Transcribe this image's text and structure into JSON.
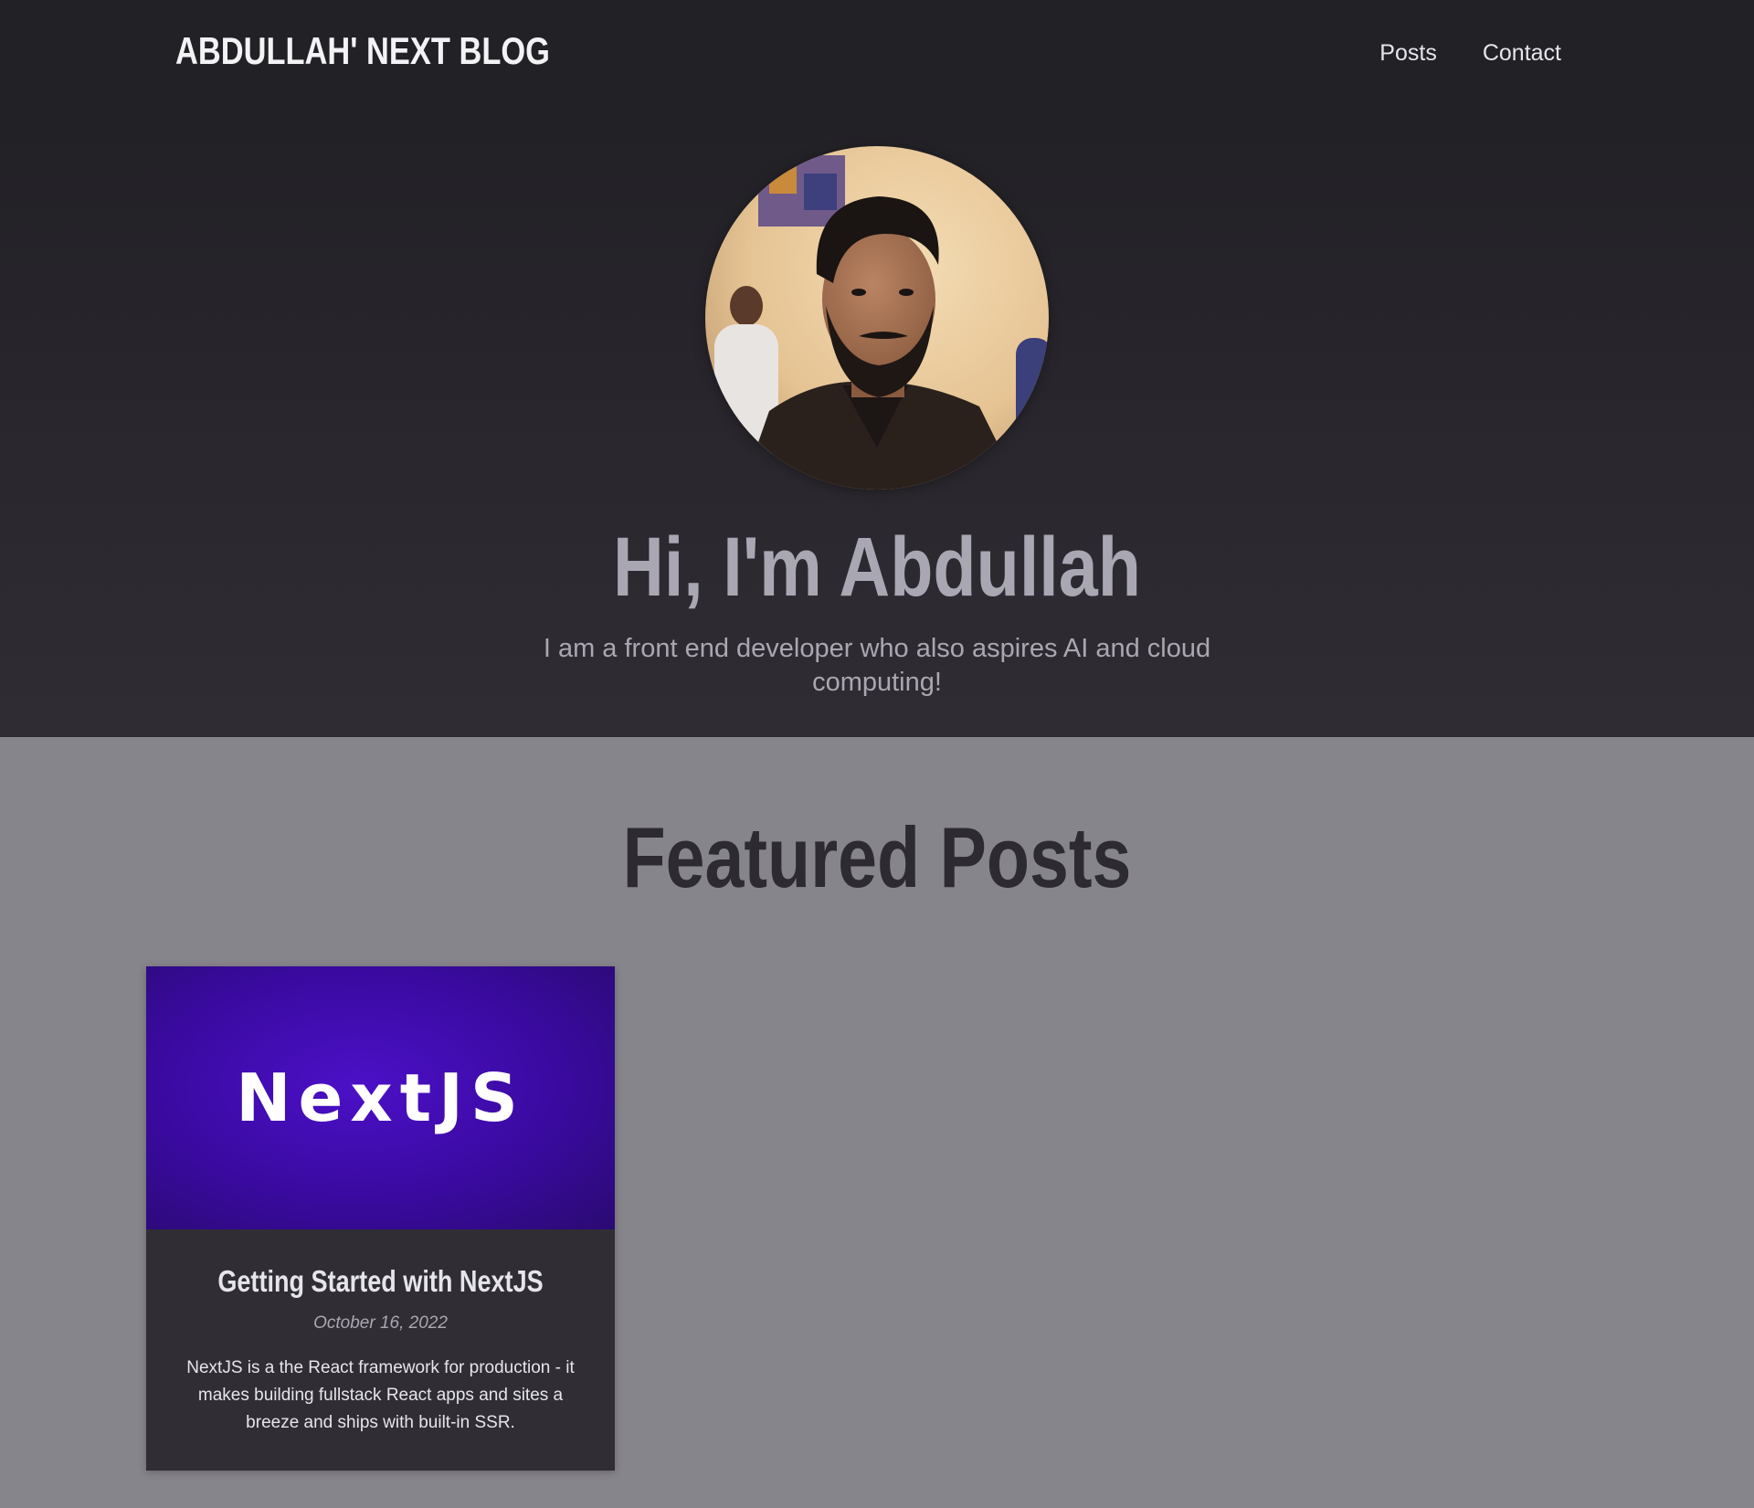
{
  "site": {
    "logo": "ABDULLAH' NEXT BLOG"
  },
  "nav": {
    "items": [
      {
        "label": "Posts"
      },
      {
        "label": "Contact"
      }
    ]
  },
  "hero": {
    "title": "Hi, I'm Abdullah",
    "subtitle": "I am a front end developer who also aspires AI and cloud computing!",
    "avatar_icon": "profile-photo"
  },
  "featured": {
    "title": "Featured Posts",
    "posts": [
      {
        "image_text": "NextJS",
        "title": "Getting Started with NextJS",
        "date": "October 16, 2022",
        "excerpt": "NextJS is a the React framework for production - it makes building fullstack React apps and sites a breeze and ships with built-in SSR."
      }
    ]
  },
  "colors": {
    "header_bg": "#222126",
    "page_bg": "#87858c",
    "card_bg": "#302d34",
    "accent_purple": "#4b10c7"
  }
}
